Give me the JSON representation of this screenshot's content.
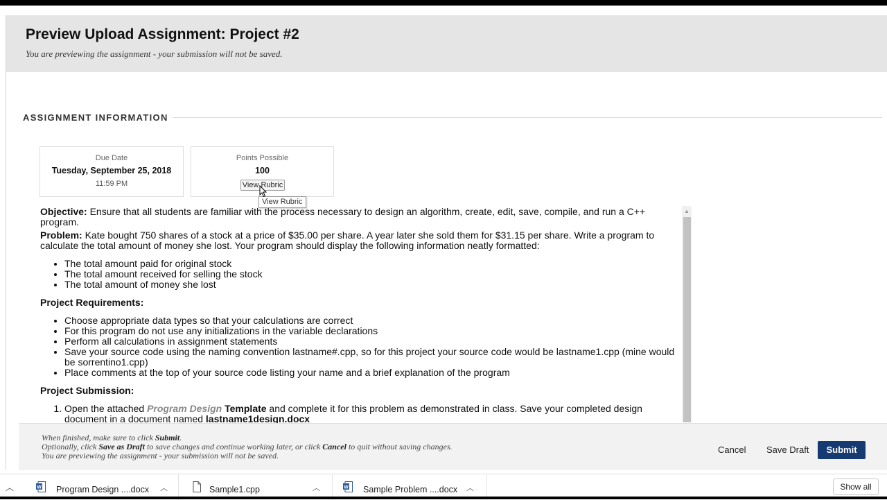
{
  "header": {
    "title": "Preview Upload Assignment: Project #2",
    "subtitle": "You are previewing the assignment - your submission will not be saved."
  },
  "section": {
    "title": "ASSIGNMENT INFORMATION"
  },
  "due": {
    "label": "Due Date",
    "date": "Tuesday, September 25, 2018",
    "time": "11:59 PM"
  },
  "points": {
    "label": "Points Possible",
    "value": "100",
    "rubric_button": "View Rubric",
    "tooltip": "View Rubric"
  },
  "content": {
    "objective_label": "Objective:",
    "objective_text": " Ensure that all students are familiar with the process necessary to design an algorithm, create, edit, save, compile, and run a C++ program.",
    "problem_label": "Problem:",
    "problem_text": " Kate bought 750 shares of a stock at a price of $35.00 per share.  A year later she sold them for $31.15 per share.  Write a program to calculate the total amount of money she lost.  Your program should display the following information neatly formatted:",
    "display_items": [
      "The total amount paid for original stock",
      "The total amount received for selling the stock",
      "The total amount of money she lost"
    ],
    "requirements_heading": "Project Requirements:",
    "requirements": [
      "Choose appropriate data types so that your calculations are correct",
      "For this program do not use any initializations in the variable declarations",
      "Perform all calculations in assignment statements",
      "Save your source code using the naming convention lastname#.cpp, so for this project your source code would be lastname1.cpp (mine would be sorrentino1.cpp)",
      "Place comments at the top of your source code listing your name and a brief explanation of the program"
    ],
    "submission_heading": "Project Submission:",
    "submission_step1": {
      "pre": "Open the attached ",
      "link": "Program Design",
      "mid": " Template",
      "post": " and complete it for this problem as demonstrated in class.  Save your completed design document in a document named ",
      "file": "lastname1design.docx"
    }
  },
  "footer": {
    "line1_pre": "When finished, make sure to click ",
    "line1_bold": "Submit",
    "line1_post": ".",
    "line2_pre": "Optionally, click ",
    "line2_bold1": "Save as Draft",
    "line2_mid": " to save changes and continue working later, or click ",
    "line2_bold2": "Cancel",
    "line2_post": " to quit without saving changes.",
    "line3": "You are previewing the assignment - your submission will not be saved.",
    "cancel": "Cancel",
    "save_draft": "Save Draft",
    "submit": "Submit"
  },
  "downloads": {
    "items": [
      {
        "name": "Program Design ....docx",
        "icon": "word-doc-icon"
      },
      {
        "name": "Sample1.cpp",
        "icon": "file-icon"
      },
      {
        "name": "Sample Problem ....docx",
        "icon": "word-doc-icon"
      }
    ],
    "show_all": "Show all"
  },
  "colors": {
    "submit_bg": "#163b73",
    "header_bg": "#e5e5e5",
    "word_blue": "#2b579a"
  }
}
